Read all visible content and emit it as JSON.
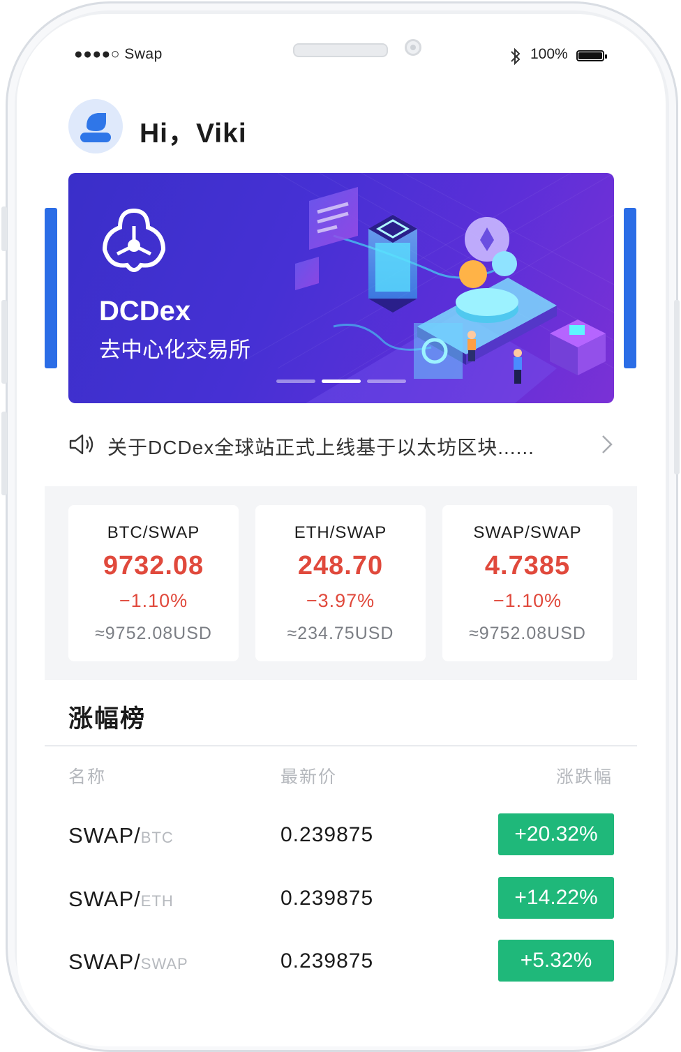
{
  "status_bar": {
    "carrier": "●●●●○ Swap",
    "battery": "100%"
  },
  "user": {
    "greeting": "Hi，Viki"
  },
  "banner": {
    "title": "DCDex",
    "subtitle": "去中心化交易所",
    "active_slide": 2,
    "slide_count": 3,
    "colors": {
      "accent": "#2b6de6",
      "background_start": "#3a2fc9",
      "background_end": "#7a31d6"
    }
  },
  "notice": {
    "text": "关于DCDex全球站正式上线基于以太坊区块......"
  },
  "tickers": [
    {
      "pair": "BTC/SWAP",
      "price": "9732.08",
      "change": "−1.10%",
      "usd": "≈9752.08USD"
    },
    {
      "pair": "ETH/SWAP",
      "price": "248.70",
      "change": "−3.97%",
      "usd": "≈234.75USD"
    },
    {
      "pair": "SWAP/SWAP",
      "price": "4.7385",
      "change": "−1.10%",
      "usd": "≈9752.08USD"
    }
  ],
  "gainers": {
    "title": "涨幅榜",
    "columns": {
      "name": "名称",
      "price": "最新价",
      "change": "涨跌幅"
    },
    "rows": [
      {
        "base": "SWAP/",
        "quote": "BTC",
        "price": "0.239875",
        "change": "+20.32%"
      },
      {
        "base": "SWAP/",
        "quote": "ETH",
        "price": "0.239875",
        "change": "+14.22%"
      },
      {
        "base": "SWAP/",
        "quote": "SWAP",
        "price": "0.239875",
        "change": "+5.32%"
      }
    ]
  },
  "colors": {
    "down": "#e0493c",
    "up_badge": "#1fb87a"
  }
}
